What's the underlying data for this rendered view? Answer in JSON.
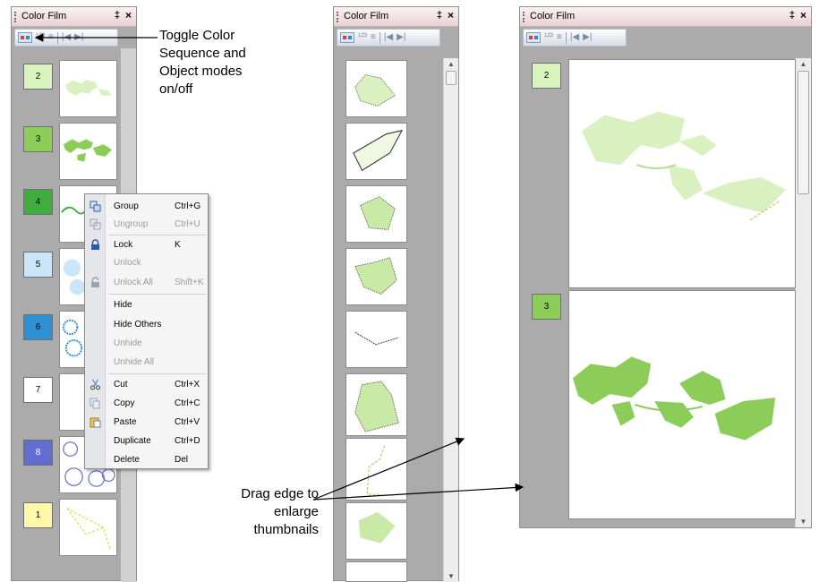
{
  "panels": [
    {
      "title": "Color Film",
      "pin": "‡",
      "close": "×"
    },
    {
      "title": "Color Film",
      "pin": "‡",
      "close": "×"
    },
    {
      "title": "Color Film",
      "pin": "‡",
      "close": "×"
    }
  ],
  "toolbar": {
    "seq": "¹²³",
    "obj": "≡",
    "first": "|◀",
    "last": "▶|"
  },
  "panel1_items": [
    {
      "num": "2",
      "color": "#d8f3bc"
    },
    {
      "num": "3",
      "color": "#8ccd5a"
    },
    {
      "num": "4",
      "color": "#3fae3f"
    },
    {
      "num": "5",
      "color": "#cbe6fa"
    },
    {
      "num": "6",
      "color": "#2f8fd3"
    },
    {
      "num": "7",
      "color": "#ffffff"
    },
    {
      "num": "8",
      "color": "#5f6ed0"
    },
    {
      "num": "1",
      "color": "#fff8a8"
    }
  ],
  "panel3_items": [
    {
      "num": "2",
      "color": "#d8f3bc"
    },
    {
      "num": "3",
      "color": "#8ccd5a"
    }
  ],
  "context_menu": {
    "group": {
      "label": "Group",
      "shortcut": "Ctrl+G"
    },
    "ungroup": {
      "label": "Ungroup",
      "shortcut": "Ctrl+U"
    },
    "lock": {
      "label": "Lock",
      "shortcut": "K"
    },
    "unlock": {
      "label": "Unlock",
      "shortcut": ""
    },
    "unlock_all": {
      "label": "Unlock All",
      "shortcut": "Shift+K"
    },
    "hide": {
      "label": "Hide",
      "shortcut": ""
    },
    "hide_others": {
      "label": "Hide Others",
      "shortcut": ""
    },
    "unhide": {
      "label": "Unhide",
      "shortcut": ""
    },
    "unhide_all": {
      "label": "Unhide All",
      "shortcut": ""
    },
    "cut": {
      "label": "Cut",
      "shortcut": "Ctrl+X"
    },
    "copy": {
      "label": "Copy",
      "shortcut": "Ctrl+C"
    },
    "paste": {
      "label": "Paste",
      "shortcut": "Ctrl+V"
    },
    "duplicate": {
      "label": "Duplicate",
      "shortcut": "Ctrl+D"
    },
    "delete": {
      "label": "Delete",
      "shortcut": "Del"
    }
  },
  "annotations": {
    "toggle": [
      "Toggle Color",
      "Sequence and",
      "Object modes",
      "on/off"
    ],
    "drag": [
      "Drag edge to",
      "enlarge",
      "thumbnails"
    ]
  }
}
